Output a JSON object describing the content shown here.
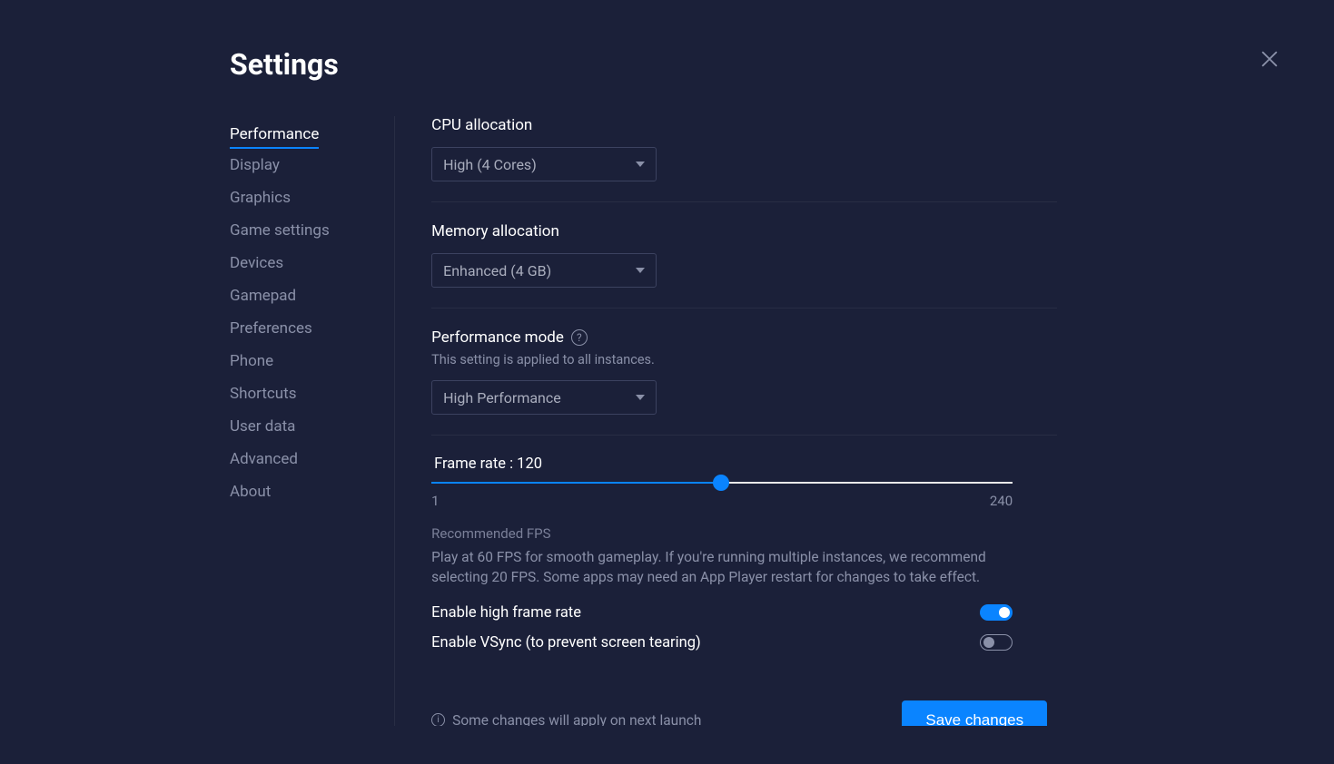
{
  "title": "Settings",
  "sidebar": {
    "items": [
      {
        "label": "Performance",
        "active": true
      },
      {
        "label": "Display"
      },
      {
        "label": "Graphics"
      },
      {
        "label": "Game settings"
      },
      {
        "label": "Devices"
      },
      {
        "label": "Gamepad"
      },
      {
        "label": "Preferences"
      },
      {
        "label": "Phone"
      },
      {
        "label": "Shortcuts"
      },
      {
        "label": "User data"
      },
      {
        "label": "Advanced"
      },
      {
        "label": "About"
      }
    ]
  },
  "cpu": {
    "label": "CPU allocation",
    "value": "High (4 Cores)"
  },
  "memory": {
    "label": "Memory allocation",
    "value": "Enhanced (4 GB)"
  },
  "perfmode": {
    "label": "Performance mode",
    "sub": "This setting is applied to all instances.",
    "value": "High Performance"
  },
  "framerate": {
    "label": "Frame rate : 120",
    "min": "1",
    "max": "240",
    "rec_title": "Recommended FPS",
    "rec_desc": "Play at 60 FPS for smooth gameplay. If you're running multiple instances, we recommend selecting 20 FPS. Some apps may need an App Player restart for changes to take effect."
  },
  "toggles": {
    "highfps": "Enable high frame rate",
    "vsync": "Enable VSync (to prevent screen tearing)"
  },
  "footer": {
    "note": "Some changes will apply on next launch",
    "save": "Save changes"
  }
}
